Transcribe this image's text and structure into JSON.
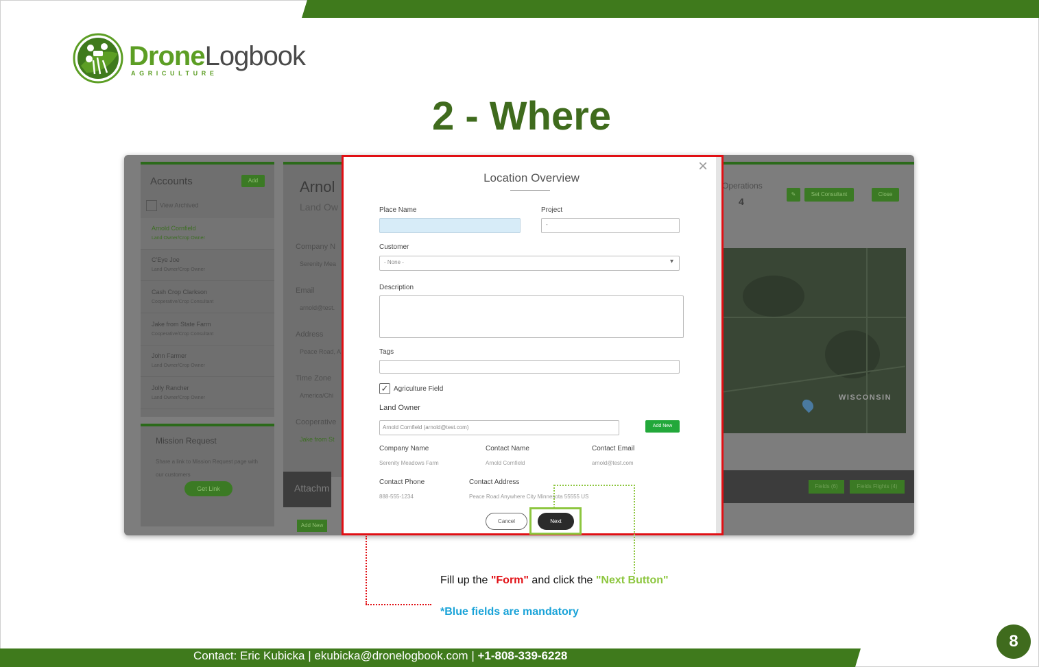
{
  "logo": {
    "word_bold": "Drone",
    "word_light": "Logbook",
    "subtitle": "AGRICULTURE"
  },
  "slide_title": "2 - Where",
  "background_app": {
    "accounts_title": "Accounts",
    "accounts_add": "Add",
    "view_archived": "View Archived",
    "accounts": [
      {
        "name": "Arnold Cornfield",
        "role": "Land Owner/Crop Owner",
        "selected": true
      },
      {
        "name": "C'Eye Joe",
        "role": "Land Owner/Crop Owner"
      },
      {
        "name": "Cash Crop Clarkson",
        "role": "Cooperative/Crop Consultant"
      },
      {
        "name": "Jake from State Farm",
        "role": "Cooperative/Crop Consultant"
      },
      {
        "name": "John Farmer",
        "role": "Land Owner/Crop Owner"
      },
      {
        "name": "Jolly Rancher",
        "role": "Land Owner/Crop Owner"
      }
    ],
    "mission_title": "Mission Request",
    "mission_desc": "Share a link to Mission Request page with our customers",
    "mission_button": "Get Link",
    "detail_name": "Arnol",
    "detail_sub": "Land Ow",
    "detail_fields": [
      {
        "label": "Company N",
        "value": "Serenity Mea"
      },
      {
        "label": "Email",
        "value": "arnold@test."
      },
      {
        "label": "Address",
        "value": "Peace Road, A"
      },
      {
        "label": "Time Zone",
        "value": "America/Chi"
      },
      {
        "label": "Cooperative",
        "value": "Jake from St"
      }
    ],
    "attach_label": "Attachm",
    "add_new_small": "Add New",
    "operations_label": "Operations",
    "operations_value": "4",
    "set_consultant": "Set Consultant",
    "close": "Close",
    "map_label": "WISCONSIN",
    "fields_tab": "Fields (6)",
    "flights_tab": "Fields Flights (4)"
  },
  "modal": {
    "title": "Location Overview",
    "place_name_label": "Place Name",
    "place_name_value": "",
    "project_label": "Project",
    "project_value": "-",
    "customer_label": "Customer",
    "customer_value": "- None -",
    "description_label": "Description",
    "tags_label": "Tags",
    "agriculture_field_label": "Agriculture Field",
    "agriculture_field_checked": true,
    "land_owner_label": "Land Owner",
    "land_owner_value": "Arnold Cornfield (arnold@test.com)",
    "add_new_label": "Add New",
    "company_name_label": "Company Name",
    "company_name_value": "Serenity Meadows Farm",
    "contact_name_label": "Contact Name",
    "contact_name_value": "Arnold Cornfield",
    "contact_email_label": "Contact Email",
    "contact_email_value": "arnold@test.com",
    "contact_phone_label": "Contact Phone",
    "contact_phone_value": "888-555-1234",
    "contact_address_label": "Contact Address",
    "contact_address_value": "Peace Road Anywhere City Minnesota 55555 US",
    "cancel_label": "Cancel",
    "next_label": "Next",
    "close_symbol": "×"
  },
  "instructions": {
    "part1": "Fill up the ",
    "form": "\"Form\"",
    "part2": " and click the ",
    "next_button": "\"Next Button\"",
    "blue_note": "*Blue fields are mandatory"
  },
  "footer": {
    "contact": "Contact: Eric Kubicka  |  ekubicka@dronelogbook.com  |  ",
    "phone": "+1-808-339-6228"
  },
  "page_number": "8",
  "colors": {
    "brand_green": "#3f7a1c",
    "title_green": "#3f6b1d",
    "highlight_red": "#e10f14",
    "highlight_lime": "#8dc63f",
    "note_blue": "#1aa3d8",
    "required_field": "#d7ecf8"
  }
}
